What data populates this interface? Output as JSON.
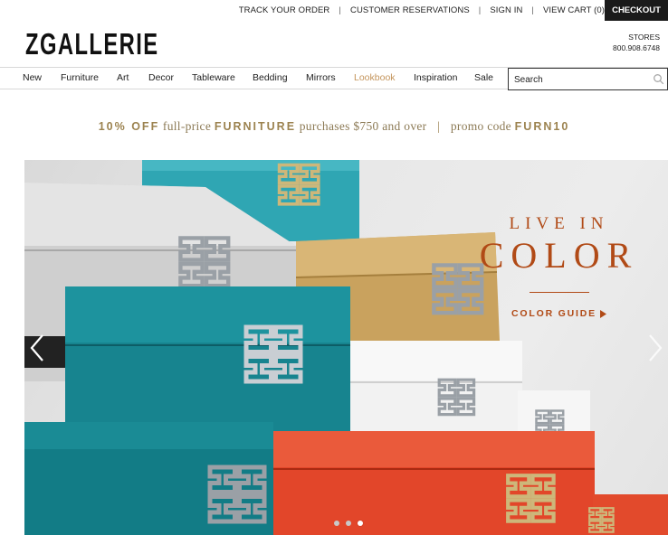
{
  "topbar": {
    "links": [
      {
        "label": "TRACK YOUR ORDER"
      },
      {
        "label": "CUSTOMER RESERVATIONS"
      },
      {
        "label": "SIGN IN"
      },
      {
        "label": "VIEW CART (0)"
      }
    ],
    "separator": "|",
    "checkout_label": "CHECKOUT"
  },
  "header": {
    "logo_text": "ZGALLERIE",
    "stores_label": "STORES",
    "phone": "800.908.6748"
  },
  "nav": {
    "items": [
      {
        "label": "New"
      },
      {
        "label": "Furniture"
      },
      {
        "label": "Art"
      },
      {
        "label": "Decor"
      },
      {
        "label": "Tableware"
      },
      {
        "label": "Bedding"
      },
      {
        "label": "Mirrors"
      },
      {
        "label": "Lookbook"
      },
      {
        "label": "Inspiration"
      },
      {
        "label": "Sale"
      }
    ],
    "active_item": "Lookbook",
    "search_placeholder": "Search"
  },
  "promo": {
    "part1": "10% OFF",
    "part2": "full-price",
    "part3": "FURNITURE",
    "part4": "purchases $750 and over",
    "separator": "|",
    "part5": "promo code",
    "part6": "FURN10"
  },
  "hero": {
    "headline_line1": "LIVE IN",
    "headline_line2": "COLOR",
    "cta_label": "COLOR GUIDE",
    "cta_icon": "triangle-right-icon",
    "prev_icon": "chevron-left-icon",
    "next_icon": "chevron-right-icon",
    "slide_count": 3,
    "active_slide": 3
  },
  "colors": {
    "accent_nav": "#c4945b",
    "promo_gold": "#9c8350",
    "headline_rust": "#b14a16",
    "checkout_bg": "#1a1a1a",
    "teal": "#1a8a93",
    "orange": "#e2462a",
    "gold": "#c8a260",
    "silver": "#d6d6d6"
  }
}
